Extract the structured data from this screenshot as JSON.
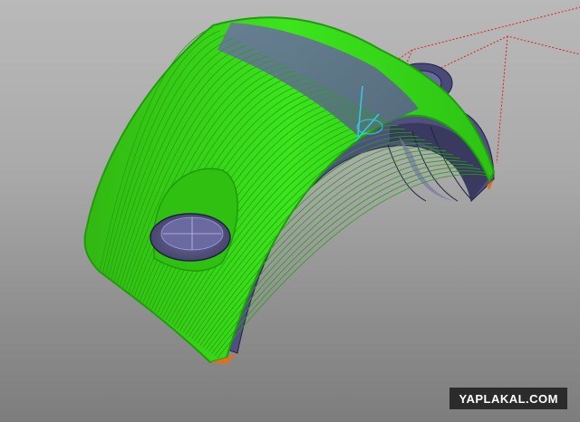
{
  "viewport": {
    "background_top": "#b9b9b9",
    "background_bottom": "#7d7d7d"
  },
  "model": {
    "surface_color": "#5f5f8a",
    "edge_color": "#202040",
    "toolpath_color": "#39e21a",
    "toolpath_dark": "#1f9c0d",
    "guide_line_color": "#e0201a",
    "tool_axis_color": "#38c8e8"
  },
  "watermark": {
    "text": "YAPLAKAL.COM"
  }
}
